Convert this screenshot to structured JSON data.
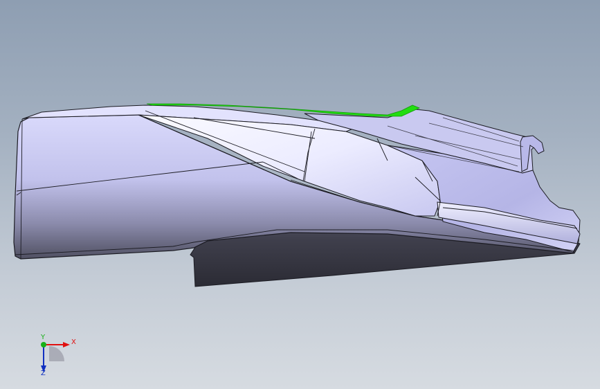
{
  "viewport": {
    "background_top": "#8e9eb2",
    "background_bottom": "#d6dbe1"
  },
  "model": {
    "name": "cad-part",
    "face_color": "#cfcff5",
    "shadow_color": "#3d3d48",
    "edge_color": "#1b1b22",
    "selected_edge_color": "#22dd11"
  },
  "triad": {
    "x_label": "X",
    "y_label": "Y",
    "z_label": "Z",
    "x_color": "#e01010",
    "y_color": "#18b018",
    "z_color": "#1030c0"
  }
}
